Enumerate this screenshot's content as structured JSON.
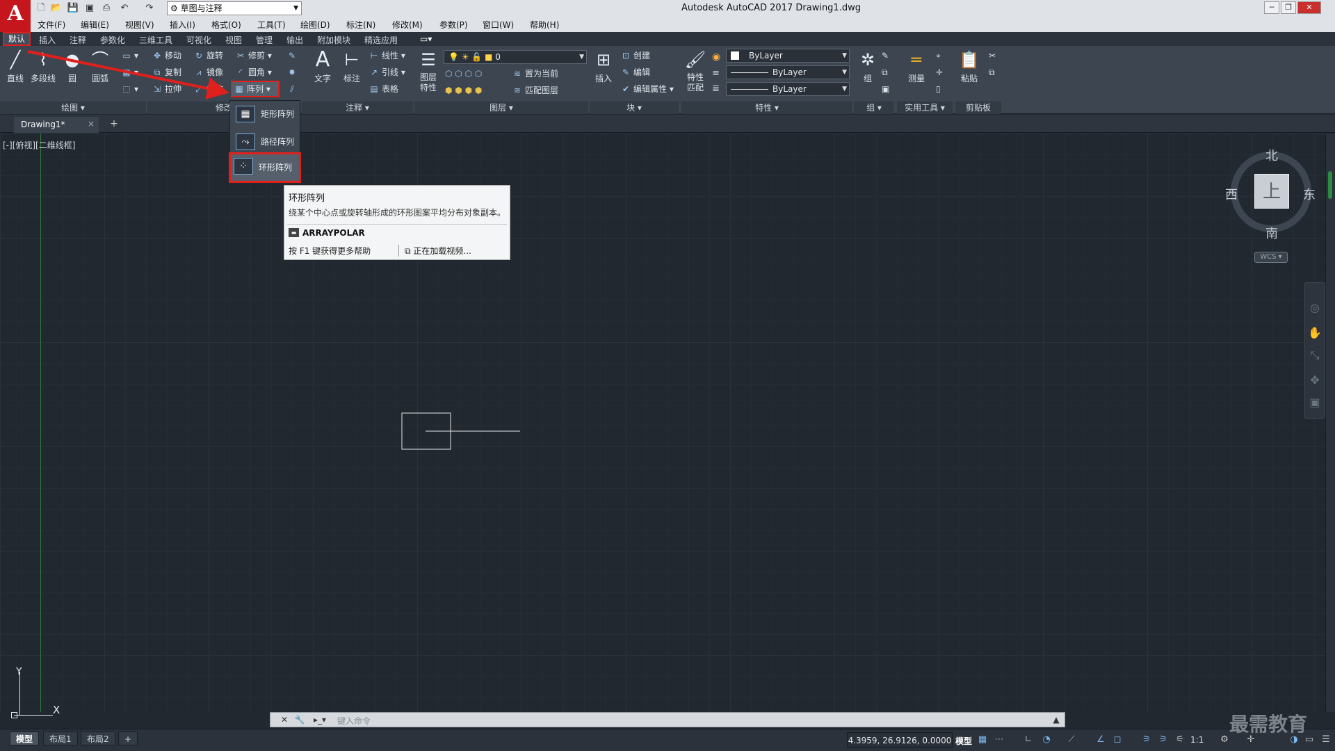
{
  "window": {
    "workspace": "草图与注释",
    "title": "Autodesk AutoCAD 2017    Drawing1.dwg",
    "logo_letter": "A"
  },
  "menu": [
    "文件(F)",
    "编辑(E)",
    "视图(V)",
    "插入(I)",
    "格式(O)",
    "工具(T)",
    "绘图(D)",
    "标注(N)",
    "修改(M)",
    "参数(P)",
    "窗口(W)",
    "帮助(H)"
  ],
  "ribbon_tabs": [
    "默认",
    "插入",
    "注释",
    "参数化",
    "三维工具",
    "可视化",
    "视图",
    "管理",
    "输出",
    "附加模块",
    "精选应用"
  ],
  "panels": {
    "draw": {
      "label": "绘图 ▾",
      "buttons": [
        "直线",
        "多段线",
        "圆",
        "圆弧"
      ]
    },
    "modify": {
      "label": "修改",
      "rows": [
        [
          "移动",
          "旋转",
          "修剪"
        ],
        [
          "复制",
          "镜像",
          "圆角"
        ],
        [
          "拉伸",
          "缩放",
          "阵列"
        ]
      ]
    },
    "annotation": {
      "label": "注释 ▾",
      "large": [
        "文字",
        "标注"
      ],
      "small": [
        "线性",
        "引线",
        "表格"
      ]
    },
    "layers": {
      "label": "图层 ▾",
      "large": "图层\n特性",
      "layer_value": "0",
      "small": [
        "置为当前",
        "匹配图层"
      ]
    },
    "block": {
      "label": "块 ▾",
      "large": "插入",
      "small": [
        "创建",
        "编辑",
        "编辑属性"
      ]
    },
    "properties": {
      "label": "特性 ▾",
      "large": "特性\n匹配",
      "combos": [
        "ByLayer",
        "ByLayer",
        "ByLayer"
      ]
    },
    "group": {
      "label": "组 ▾",
      "large": "组"
    },
    "utilities": {
      "label": "实用工具 ▾",
      "large": "测量"
    },
    "clipboard": {
      "label": "剪贴板",
      "large": "粘贴"
    }
  },
  "doc_tab": {
    "name": "Drawing1*",
    "close": "×",
    "add": "+"
  },
  "viewport_label": "[-][俯视][二维线框]",
  "array_dropdown": [
    "矩形阵列",
    "路径阵列",
    "环形阵列"
  ],
  "tooltip": {
    "title": "环形阵列",
    "description": "绕某个中心点或旋转轴形成的环形图案平均分布对象副本。",
    "command": "ARRAYPOLAR",
    "f1_help": "按 F1 键获得更多帮助",
    "video": "正在加载视频..."
  },
  "viewcube": {
    "north": "北",
    "south": "南",
    "west": "西",
    "east": "东",
    "face": "上",
    "wcs": "WCS ▾"
  },
  "ucs": {
    "x": "X",
    "y": "Y"
  },
  "command_line": {
    "placeholder": "键入命令"
  },
  "layout_tabs": [
    "模型",
    "布局1",
    "布局2",
    "+"
  ],
  "status": {
    "coords": "4.3959, 26.9126, 0.0000",
    "model": "模型",
    "scale": "1:1"
  },
  "watermark": "最需教育",
  "colors": {
    "accent_red": "#e0201c",
    "canvas": "#212830",
    "ribbon": "#3c4550"
  }
}
